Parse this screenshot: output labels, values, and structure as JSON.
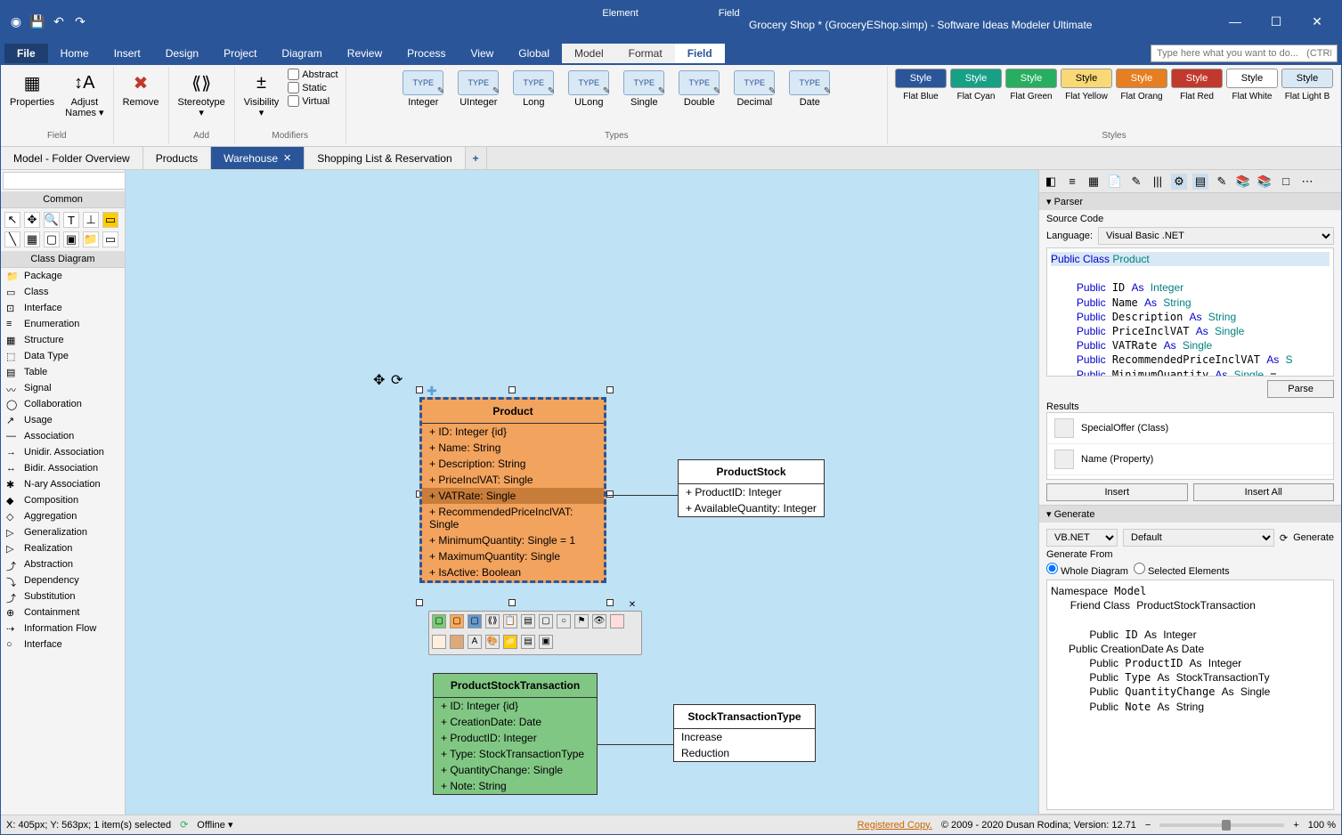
{
  "app": {
    "doc_title": "Grocery Shop * (GroceryEShop.simp) - Software Ideas Modeler Ultimate",
    "context_tabs": {
      "element": "Element",
      "field": "Field"
    }
  },
  "menubar": {
    "items": [
      "File",
      "Home",
      "Insert",
      "Design",
      "Project",
      "Diagram",
      "Review",
      "Process",
      "View",
      "Global",
      "Model",
      "Format",
      "Field"
    ],
    "search_placeholder": "Type here what you want to do...   (CTRL+Q)"
  },
  "ribbon": {
    "field_group": {
      "properties": "Properties",
      "adjust": "Adjust\nNames ▾",
      "label": "Field"
    },
    "remove_group": {
      "remove": "Remove"
    },
    "add_group": {
      "stereotype": "Stereotype\n▾",
      "label": "Add"
    },
    "modifiers_group": {
      "visibility": "Visibility\n▾",
      "abstract": "Abstract",
      "static": "Static",
      "virtual": "Virtual",
      "label": "Modifiers"
    },
    "types_group": {
      "integer": "Integer",
      "uinteger": "UInteger",
      "long": "Long",
      "ulong": "ULong",
      "single": "Single",
      "double": "Double",
      "decimal": "Decimal",
      "date": "Date",
      "label": "Types"
    },
    "styles_group": {
      "style_label": "Style",
      "flat_blue": "Flat Blue",
      "flat_cyan": "Flat Cyan",
      "flat_green": "Flat Green",
      "flat_yellow": "Flat Yellow",
      "flat_orang": "Flat Orang",
      "flat_red": "Flat Red",
      "flat_white": "Flat White",
      "flat_lightb": "Flat Light B",
      "label": "Styles"
    }
  },
  "doc_tabs": {
    "overview": "Model - Folder Overview",
    "products": "Products",
    "warehouse": "Warehouse",
    "shopping": "Shopping List & Reservation"
  },
  "toolbox": {
    "common": "Common",
    "class_diagram": "Class Diagram",
    "items": [
      "Package",
      "Class",
      "Interface",
      "Enumeration",
      "Structure",
      "Data Type",
      "Table",
      "Signal",
      "Collaboration",
      "Usage",
      "Association",
      "Unidir. Association",
      "Bidir. Association",
      "N-ary Association",
      "Composition",
      "Aggregation",
      "Generalization",
      "Realization",
      "Abstraction",
      "Dependency",
      "Substitution",
      "Containment",
      "Information Flow",
      "Interface"
    ]
  },
  "canvas": {
    "product": {
      "title": "Product",
      "attrs": [
        "+ ID: Integer {id}",
        "+ Name: String",
        "+ Description: String",
        "+ PriceInclVAT: Single",
        "+ VATRate: Single",
        "+ RecommendedPriceInclVAT: Single",
        "+ MinimumQuantity: Single = 1",
        "+ MaximumQuantity: Single",
        "+ IsActive: Boolean"
      ]
    },
    "stock": {
      "title": "ProductStock",
      "attrs": [
        "+ ProductID: Integer",
        "+ AvailableQuantity: Integer"
      ]
    },
    "stock_trans": {
      "title": "ProductStockTransaction",
      "attrs": [
        "+ ID: Integer {id}",
        "+ CreationDate: Date",
        "+ ProductID: Integer",
        "+ Type: StockTransactionType",
        "+ QuantityChange: Single",
        "+ Note: String"
      ]
    },
    "trans_type": {
      "title": "StockTransactionType",
      "attrs": [
        "Increase",
        "Reduction"
      ]
    }
  },
  "parser": {
    "title": "Parser",
    "source_code_label": "Source Code",
    "language_label": "Language:",
    "language_value": "Visual Basic .NET",
    "results_label": "Results",
    "parse_btn": "Parse",
    "results": [
      "SpecialOffer (Class)",
      "Name (Property)"
    ],
    "insert_btn": "Insert",
    "insert_all_btn": "Insert All"
  },
  "generate": {
    "title": "Generate",
    "lang": "VB.NET",
    "template": "Default",
    "generate_btn": "Generate",
    "from_label": "Generate From",
    "whole": "Whole Diagram",
    "selected": "Selected Elements"
  },
  "statusbar": {
    "pos": "X: 405px; Y: 563px; 1 item(s) selected",
    "offline": "Offline ▾",
    "registered": "Registered Copy.",
    "copyright": "© 2009 - 2020 Dusan Rodina; Version: 12.71",
    "zoom": "100 %"
  }
}
